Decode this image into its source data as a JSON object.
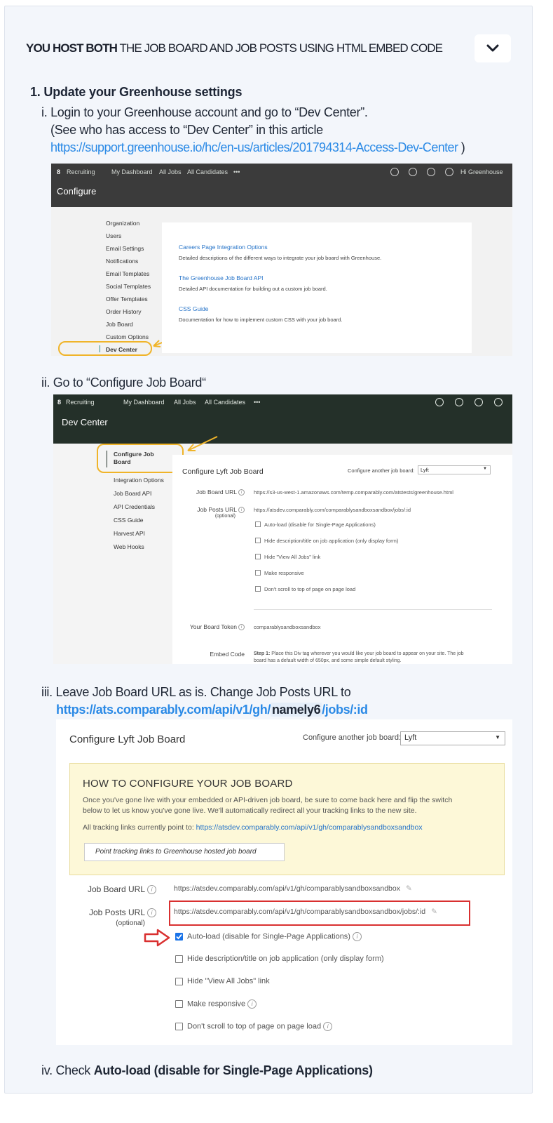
{
  "header": {
    "title_bold": "YOU HOST BOTH",
    "title_rest": " THE JOB BOARD AND JOB POSTS USING HTML EMBED CODE",
    "toggle_icon": "chevron-down-icon"
  },
  "step": {
    "title": "1. Update your Greenhouse settings"
  },
  "sub_i": {
    "line1": "i. Login to your Greenhouse account and go to “Dev Center”.",
    "line2": "(See who has access to “Dev Center” in this article",
    "link": "https://support.greenhouse.io/hc/en-us/articles/201794314-Access-Dev-Center",
    "close": " )"
  },
  "shot1": {
    "nav": [
      "Recruiting",
      "My Dashboard",
      "All Jobs",
      "All Candidates",
      "•••"
    ],
    "user": "Hi Greenhouse",
    "title": "Configure",
    "menu": [
      "Organization",
      "Users",
      "Email Settings",
      "Notifications",
      "Email Templates",
      "Social Templates",
      "Offer Templates",
      "Order History",
      "Job Board",
      "Custom Options",
      "Dev Center"
    ],
    "links": [
      {
        "title": "Careers Page Integration Options",
        "desc": "Detailed descriptions of the different ways to integrate your job board with Greenhouse."
      },
      {
        "title": "The Greenhouse Job Board API",
        "desc": "Detailed API documentation for building out a custom job board."
      },
      {
        "title": "CSS Guide",
        "desc": "Documentation for how to implement custom CSS with your job board."
      }
    ]
  },
  "sub_ii": {
    "line1": "ii. Go to “Configure Job Board“"
  },
  "shot2": {
    "nav": [
      "Recruiting",
      "My Dashboard",
      "All Jobs",
      "All Candidates",
      "•••"
    ],
    "title": "Dev Center",
    "menu_top": "Configure Job Board",
    "menu": [
      "Integration Options",
      "Job Board API",
      "API Credentials",
      "CSS Guide",
      "Harvest API",
      "Web Hooks"
    ],
    "panel_title": "Configure Lyft Job Board",
    "another_label": "Configure another job board:",
    "another_value": "Lyft",
    "job_board_url_label": "Job Board URL",
    "job_board_url": "https://s3-us-west-1.amazonaws.com/temp.comparably.com/atstests/greenhouse.html",
    "job_posts_url_label": "Job Posts URL",
    "optional": "(optional)",
    "job_posts_url": "https://atsdev.comparably.com/comparablysandboxsandbox/jobs/:id",
    "checkboxes": [
      "Auto-load (disable for Single-Page Applications)",
      "Hide description/title on job application (only display form)",
      "Hide \"View All Jobs\" link",
      "Make responsive",
      "Don't scroll to top of page on page load"
    ],
    "token_label": "Your Board Token",
    "token": "comparablysandboxsandbox",
    "embed_label": "Embed Code",
    "embed_step": "Step 1:",
    "embed_text1": " Place this Div tag wherever you would like your job board to appear on your site. The job",
    "embed_text2": "board has a default width of 650px, and some simple default styling."
  },
  "sub_iii": {
    "line1": "iii. Leave Job Board URL as is. Change Job Posts URL to",
    "url_a": "https://ats.comparably.com/api/v1/gh/",
    "url_hl": "namely6",
    "url_b": "/jobs/:id"
  },
  "shot3": {
    "panel_title": "Configure Lyft Job Board",
    "another_label": "Configure another job board:",
    "another_value": "Lyft",
    "howto_title": "HOW TO CONFIGURE YOUR JOB BOARD",
    "howto_text1": "Once you've gone live with your embedded or API-driven job board, be sure to come back here and flip the switch",
    "howto_text2": "below to let us know you've gone live. We'll automatically redirect all your tracking links to the new site.",
    "tracking_label": "All tracking links currently point to: ",
    "tracking_link": "https://atsdev.comparably.com/api/v1/gh/comparablysandboxsandbox",
    "point_button": "Point tracking links to Greenhouse hosted job board",
    "job_board_url_label": "Job Board URL",
    "job_board_url": "https://atsdev.comparably.com/api/v1/gh/comparablysandboxsandbox",
    "job_posts_url_label": "Job Posts URL",
    "optional": "(optional)",
    "job_posts_url": "https://atsdev.comparably.com/api/v1/gh/comparablysandboxsandbox/jobs/:id",
    "checkboxes": [
      "Auto-load (disable for Single-Page Applications)",
      "Hide description/title on job application (only display form)",
      "Hide \"View All Jobs\" link",
      "Make responsive",
      "Don't scroll to top of page on page load"
    ],
    "checked_index": 0,
    "colors": {
      "highlight_border": "#d93030",
      "arrow": "#d93030",
      "notice_bg": "#fdf8d8"
    }
  },
  "sub_iv": {
    "prefix": "iv. Check ",
    "bold": "Auto-load (disable for Single-Page Applications)"
  },
  "colors": {
    "link": "#2b8ae6",
    "card_bg": "#f3f6fb",
    "orange": "#f0b429",
    "gh_dark": "#3b3b3b",
    "gh_green": "#243029"
  }
}
